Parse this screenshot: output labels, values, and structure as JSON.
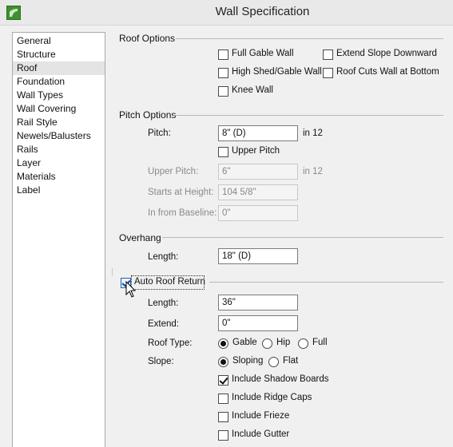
{
  "window": {
    "title": "Wall Specification"
  },
  "sidebar": {
    "items": [
      {
        "label": "General"
      },
      {
        "label": "Structure"
      },
      {
        "label": "Roof",
        "selected": true
      },
      {
        "label": "Foundation"
      },
      {
        "label": "Wall Types"
      },
      {
        "label": "Wall Covering"
      },
      {
        "label": "Rail Style"
      },
      {
        "label": "Newels/Balusters"
      },
      {
        "label": "Rails"
      },
      {
        "label": "Layer"
      },
      {
        "label": "Materials"
      },
      {
        "label": "Label"
      }
    ]
  },
  "roof_options": {
    "heading": "Roof Options",
    "full_gable_wall": {
      "label": "Full Gable Wall",
      "checked": false
    },
    "high_shed_gable_wall": {
      "label": "High Shed/Gable Wall",
      "checked": false
    },
    "knee_wall": {
      "label": "Knee Wall",
      "checked": false
    },
    "extend_slope_downward": {
      "label": "Extend Slope Downward",
      "checked": false
    },
    "roof_cuts_wall_at_bottom": {
      "label": "Roof Cuts Wall at Bottom",
      "checked": false
    }
  },
  "pitch_options": {
    "heading": "Pitch Options",
    "pitch_label": "Pitch:",
    "pitch_value": "8\" (D)",
    "pitch_unit": "in 12",
    "upper_pitch_checkbox": {
      "label": "Upper Pitch",
      "checked": false
    },
    "upper_pitch_label": "Upper Pitch:",
    "upper_pitch_value": "6\"",
    "upper_pitch_unit": "in 12",
    "starts_at_height_label": "Starts at Height:",
    "starts_at_height_value": "104 5/8\"",
    "in_from_baseline_label": "In from Baseline:",
    "in_from_baseline_value": "0\""
  },
  "overhang": {
    "heading": "Overhang",
    "length_label": "Length:",
    "length_value": "18\" (D)"
  },
  "auto_roof_return": {
    "label": "Auto Roof Return",
    "checked": true,
    "length_label": "Length:",
    "length_value": "36\"",
    "extend_label": "Extend:",
    "extend_value": "0\"",
    "roof_type_label": "Roof Type:",
    "roof_type_options": [
      "Gable",
      "Hip",
      "Full"
    ],
    "roof_type_selected": "Gable",
    "slope_label": "Slope:",
    "slope_options": [
      "Sloping",
      "Flat"
    ],
    "slope_selected": "Sloping",
    "include_shadow_boards": {
      "label": "Include Shadow Boards",
      "checked": true
    },
    "include_ridge_caps": {
      "label": "Include Ridge Caps",
      "checked": false
    },
    "include_frieze": {
      "label": "Include Frieze",
      "checked": false
    },
    "include_gutter": {
      "label": "Include Gutter",
      "checked": false
    }
  },
  "icons": {
    "app": "app-icon",
    "cursor": "mouse-pointer-icon"
  }
}
